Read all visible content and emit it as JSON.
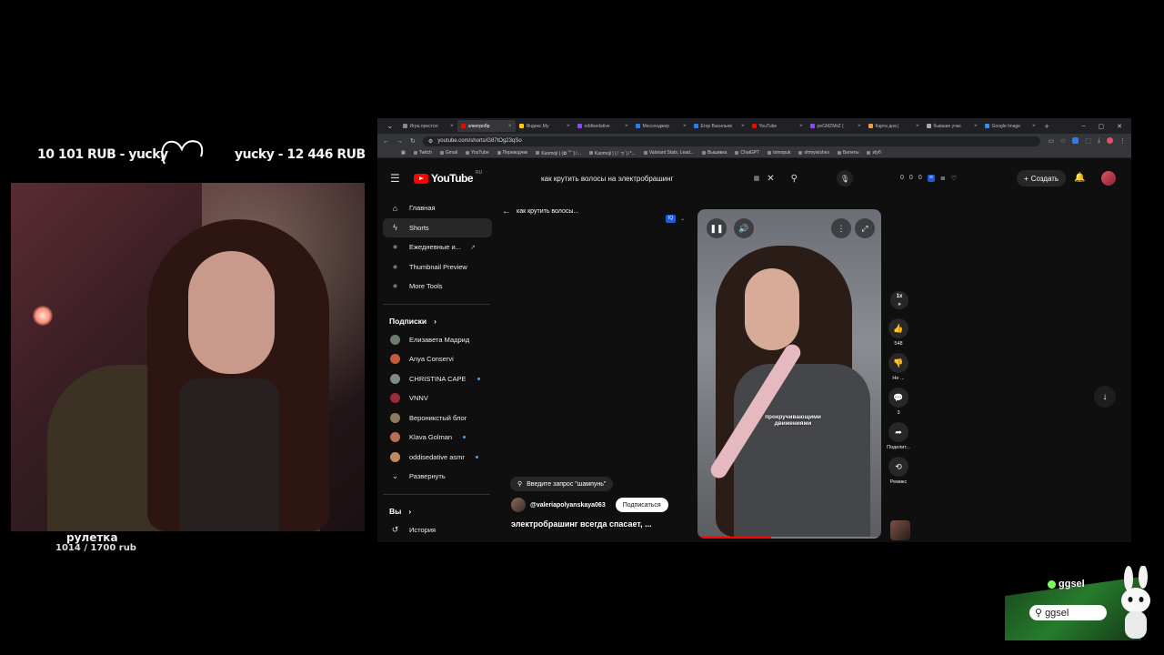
{
  "overlay": {
    "donation_left": "10 101 RUB - yucky",
    "donation_right": "yucky - 12 446 RUB",
    "roulette_title": "рулетка",
    "roulette_value": "1014 / 1700 rub"
  },
  "browser": {
    "tabs": [
      {
        "label": "Игра престол",
        "color": "#888",
        "active": false
      },
      {
        "label": "электробр",
        "color": "#ff0000",
        "active": true
      },
      {
        "label": "Яндекс.Му",
        "color": "#ffcc00",
        "active": false
      },
      {
        "label": "oddisedative",
        "color": "#9146ff",
        "active": false
      },
      {
        "label": "Мессенджер",
        "color": "#2d7cf6",
        "active": false
      },
      {
        "label": "Егор Васильев",
        "color": "#2d7cf6",
        "active": false
      },
      {
        "label": "YouTube",
        "color": "#ff0000",
        "active": false
      },
      {
        "label": "peGMZMiiZ (",
        "color": "#9146ff",
        "active": false
      },
      {
        "label": "Карта дна |",
        "color": "#e8a33d",
        "active": false
      },
      {
        "label": "бывшие учас",
        "color": "#aaa",
        "active": false
      },
      {
        "label": "Google Image",
        "color": "#4285f4",
        "active": false
      }
    ],
    "url": "youtube.com/shorts/G87tOg23qSo",
    "bookmarks": [
      "Twitch",
      "Gmail",
      "YouTube",
      "Переводчик",
      "Kaomoji | (✿´꒳`)ﾉ...",
      "Kaomoji | (ﾉ´ヮ`)ﾉ*...",
      "Valorant Stats, Lead...",
      "Вышивка",
      "ChatGPT",
      "tomopuk",
      "ohmywishes",
      "Билеты",
      "stуб"
    ]
  },
  "youtube": {
    "logo_text": "YouTube",
    "country": "RU",
    "search_query": "как крутить волосы на электробрашинг",
    "stats": [
      "0",
      "0",
      "0"
    ],
    "create_label": "Создать",
    "sidebar_main": [
      {
        "label": "Главная",
        "icon": "home-icon"
      },
      {
        "label": "Shorts",
        "icon": "shorts-icon"
      },
      {
        "label": "Ежедневные и...",
        "icon": "extension-icon"
      },
      {
        "label": "Thumbnail Preview",
        "icon": "extension-icon"
      },
      {
        "label": "More Tools",
        "icon": "extension-icon"
      }
    ],
    "subscriptions_heading": "Подписки",
    "subscriptions": [
      {
        "label": "Елизавета Мадрид",
        "color": "#6b7b6e",
        "live": false
      },
      {
        "label": "Anya Conservi",
        "color": "#c65a3a",
        "live": false
      },
      {
        "label": "CHRISTINA CAPE",
        "color": "#7d8c7f",
        "live": true
      },
      {
        "label": "VNNV",
        "color": "#9c2a3a",
        "live": false
      },
      {
        "label": "Вероникстый блог",
        "color": "#8d7a5e",
        "live": false
      },
      {
        "label": "Klava Golman",
        "color": "#b86d4f",
        "live": true
      },
      {
        "label": "oddisedative asmr",
        "color": "#c28a5b",
        "live": true
      }
    ],
    "expand_label": "Развернуть",
    "you_heading": "Вы",
    "history_label": "История",
    "back_label": "как крутить волосы...",
    "video": {
      "caption": "прокручивающими движениями",
      "speed_label": "1x",
      "likes": "548",
      "dislike_label": "Не ...",
      "comments": "3",
      "share_label": "Поделит...",
      "remix_label": "Ремикс",
      "progress": 0.4
    },
    "query_chip": "Введите запрос \"шампунь\"",
    "channel_handle": "@valeriapolyanskaya063",
    "subscribe_label": "Подписаться",
    "video_title": "электробрашинг всегда спасает, ..."
  },
  "ggsel": {
    "brand": "ggsel",
    "search_text": "ggsel"
  }
}
